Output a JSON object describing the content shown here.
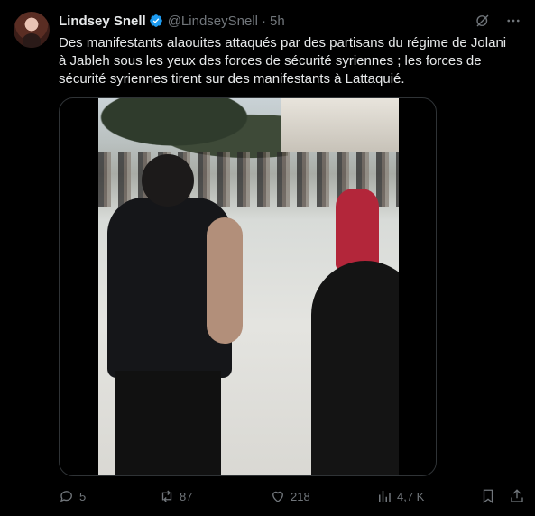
{
  "tweet": {
    "author_name": "Lindsey Snell",
    "handle": "@LindseySnell",
    "separator": "·",
    "time": "5h",
    "text": "Des manifestants alaouites attaqués par des partisans du régime de Jolani à Jableh sous les yeux des forces de sécurité syriennes ; les forces de sécurité syriennes tirent sur des manifestants à Lattaquié."
  },
  "icons": {
    "verified": "verified-badge-icon",
    "grok": "grok-icon",
    "more": "more-icon",
    "reply": "reply-icon",
    "retweet": "retweet-icon",
    "like": "like-icon",
    "views": "views-icon",
    "bookmark": "bookmark-icon",
    "share": "share-icon"
  },
  "stats": {
    "replies": "5",
    "retweets": "87",
    "likes": "218",
    "views": "4,7 K"
  },
  "colors": {
    "background": "#000000",
    "text": "#e7e9ea",
    "muted": "#71767b",
    "verified": "#1d9bf0",
    "border": "#2f3336"
  }
}
